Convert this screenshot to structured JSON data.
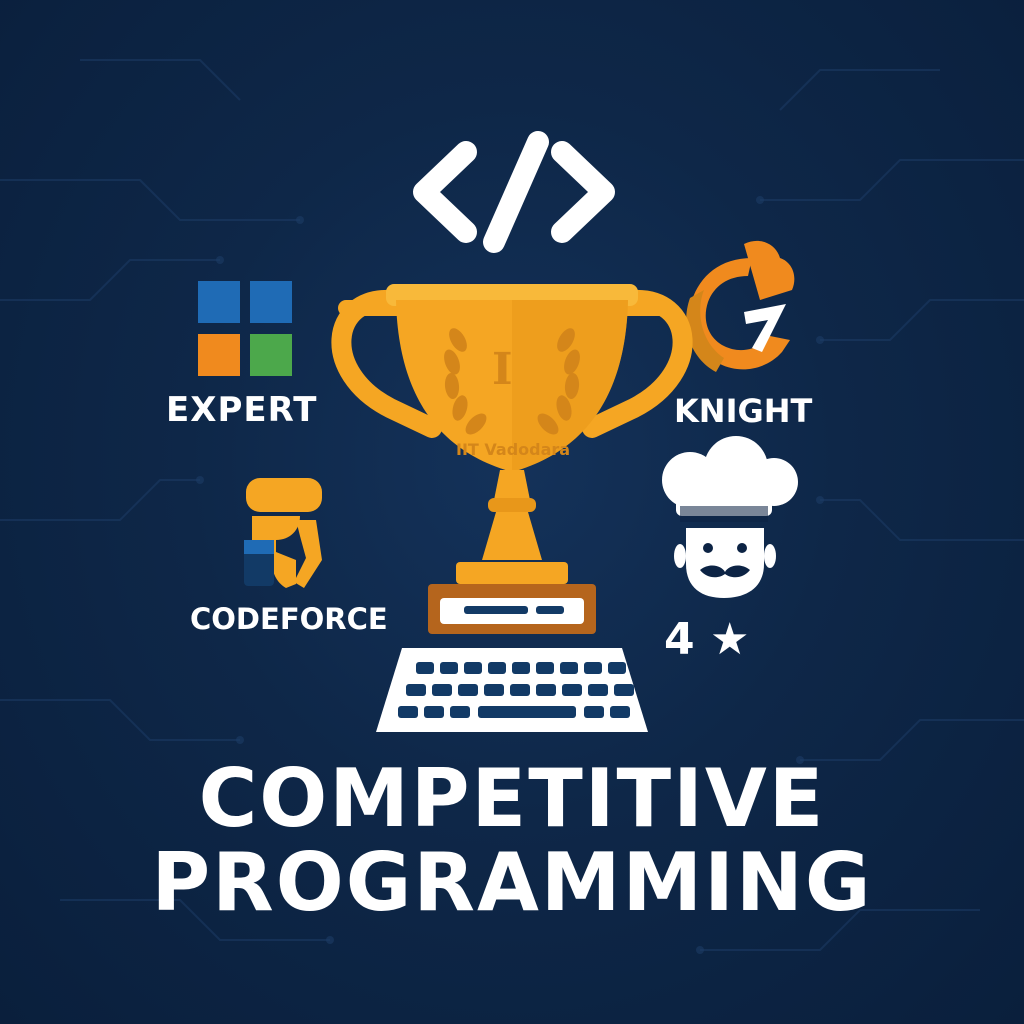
{
  "colors": {
    "background": "#0c2344",
    "gold": "#f5a623",
    "gold_dark": "#d4861a",
    "white": "#ffffff",
    "blue": "#1f6bb5",
    "orange": "#f08a1e",
    "green": "#4ca84b",
    "navy_tile": "#123a66"
  },
  "icons": {
    "code": "code-brackets-icon",
    "trophy": "trophy-icon",
    "keyboard": "keyboard-icon",
    "expert_logo": "four-squares-logo-icon",
    "knight_logo": "knight-logo-icon",
    "codeforce_logo": "codeforce-logo-icon",
    "chef": "chef-icon",
    "star": "star-icon"
  },
  "badges": {
    "expert": "EXPERT",
    "knight": "KNIGHT",
    "codeforce": "CODEFORCE",
    "rating_number": "4",
    "rating_star": "★"
  },
  "trophy_text": {
    "letter": "I",
    "institute": "IIT Vadodara"
  },
  "title": {
    "line1": "COMPETITIVE",
    "line2": "PROGRAMMING"
  }
}
